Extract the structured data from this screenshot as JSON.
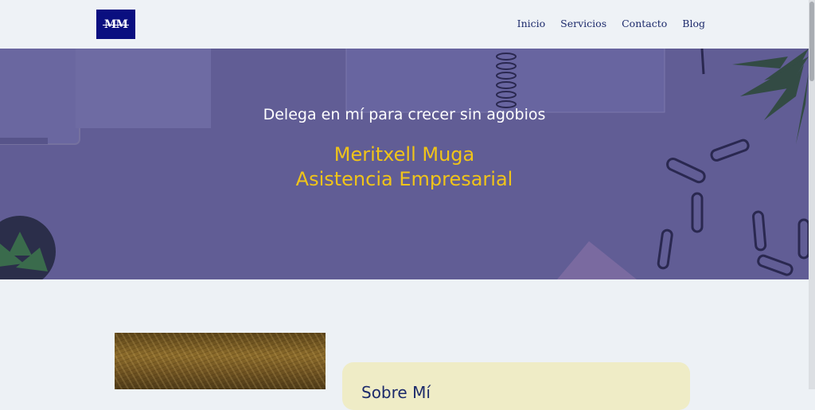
{
  "header": {
    "logo_text": "MM",
    "nav": [
      "Inicio",
      "Servicios",
      "Contacto",
      "Blog"
    ]
  },
  "hero": {
    "subtitle": "Delega en mí para crecer sin agobios",
    "title_line1": "Meritxell Muga",
    "title_line2": "Asistencia Empresarial"
  },
  "about": {
    "title": "Sobre Mí"
  },
  "colors": {
    "accent": "#f0c419",
    "brand": "#0a0f80",
    "hero_bg": "#615d95",
    "card_bg": "#efecc6"
  }
}
